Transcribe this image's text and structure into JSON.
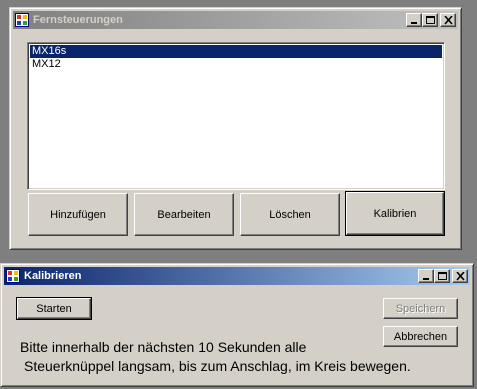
{
  "remote_window": {
    "title": "Fernsteuerungen",
    "list_items": [
      "MX16s",
      "MX12"
    ],
    "selected_index": 0,
    "buttons": {
      "add": "Hinzufügen",
      "edit": "Bearbeiten",
      "delete": "Löschen",
      "calibrate": "Kalibrien"
    }
  },
  "calibrate_window": {
    "title": "Kalibrieren",
    "start_label": "Starten",
    "save_label": "Speichern",
    "cancel_label": "Abbrechen",
    "instruction_line1": "Bitte innerhalb der nächsten 10 Sekunden alle",
    "instruction_line2": "Steuerknüppel langsam, bis zum Anschlag, im Kreis bewegen."
  },
  "colors": {
    "active_title": "#0a246a",
    "inactive_title": "#808080",
    "selection": "#0a246a",
    "face": "#d4d0c8"
  }
}
